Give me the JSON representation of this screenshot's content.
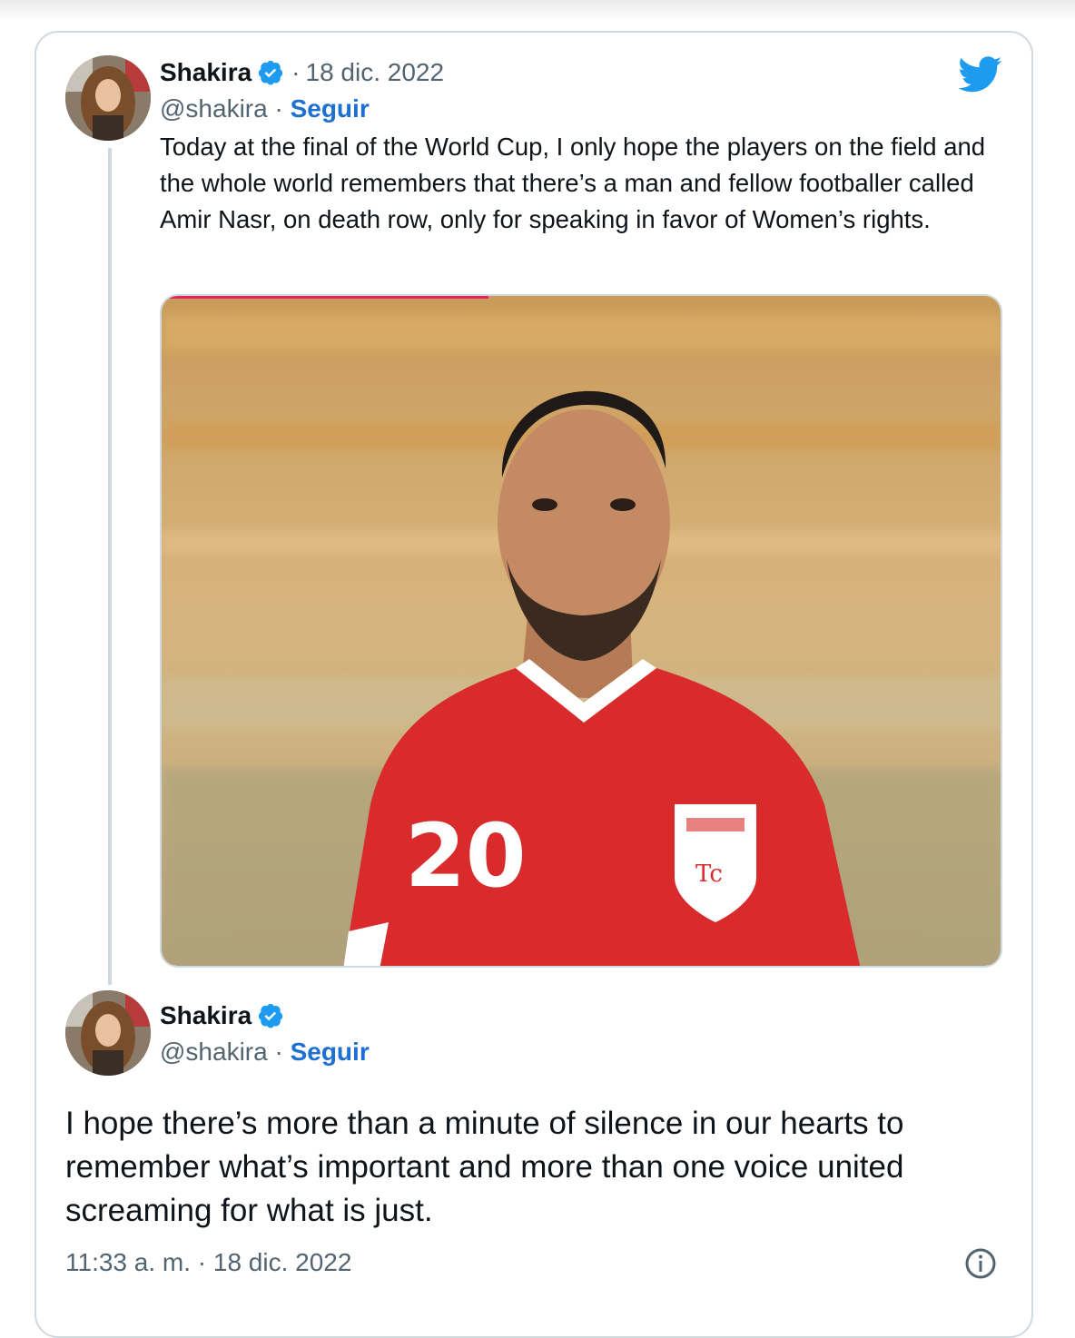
{
  "quoted_tweet": {
    "author_name": "Shakira",
    "handle": "@shakira",
    "separator": "·",
    "follow_label": "Seguir",
    "date": "18 dic. 2022",
    "text": "Today at the final of the World Cup, I only hope the players on the field and the whole world remembers that there’s a man and fellow footballer called Amir Nasr, on death row, only for speaking in favor of Women’s rights.",
    "media": {
      "jersey_number": "20",
      "progress_fraction": 0.39
    }
  },
  "main_tweet": {
    "author_name": "Shakira",
    "handle": "@shakira",
    "separator": "·",
    "follow_label": "Seguir",
    "text": "I hope there’s more than a minute of silence in our hearts to remember what’s important and more than one voice united screaming for what is just.",
    "timestamp": "11:33 a. m. · 18 dic. 2022"
  },
  "icons": {
    "brand": "twitter-bird-icon",
    "verified": "verified-badge-icon",
    "info": "info-icon"
  },
  "colors": {
    "twitter_blue": "#1d9bf0",
    "follow_blue": "#1d6fd1",
    "secondary_text": "#536471",
    "border": "#cfd9de",
    "jersey_red": "#d92b2b"
  }
}
